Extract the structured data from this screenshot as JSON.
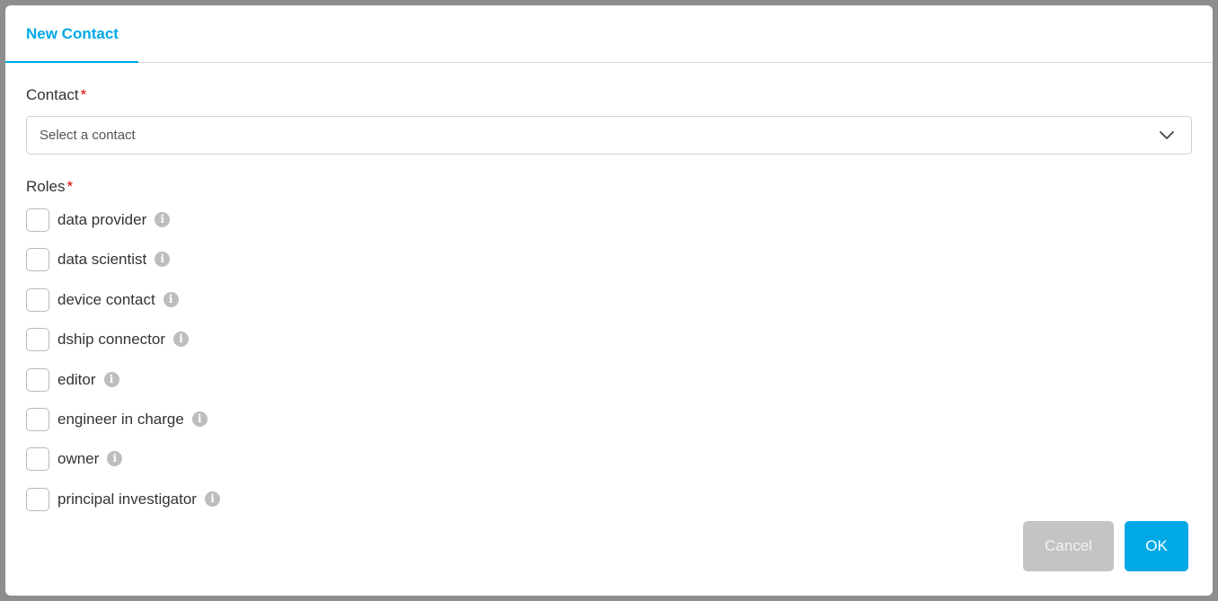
{
  "dialog": {
    "tab_label": "New Contact"
  },
  "contact": {
    "label": "Contact",
    "required_mark": "*",
    "placeholder": "Select a contact"
  },
  "roles": {
    "label": "Roles",
    "required_mark": "*",
    "items": [
      {
        "label": "data provider",
        "checked": false
      },
      {
        "label": "data scientist",
        "checked": false
      },
      {
        "label": "device contact",
        "checked": false
      },
      {
        "label": "dship connector",
        "checked": false
      },
      {
        "label": "editor",
        "checked": false
      },
      {
        "label": "engineer in charge",
        "checked": false
      },
      {
        "label": "owner",
        "checked": false
      },
      {
        "label": "principal investigator",
        "checked": false
      }
    ],
    "info_glyph": "i"
  },
  "buttons": {
    "cancel": "Cancel",
    "ok": "OK"
  },
  "colors": {
    "accent": "#00a8e6",
    "required": "#e00000",
    "cancel_bg": "#c4c4c4",
    "info_bg": "#bdbdbd"
  },
  "icons": {
    "dropdown": "chevron-down-icon",
    "info": "info-icon"
  }
}
